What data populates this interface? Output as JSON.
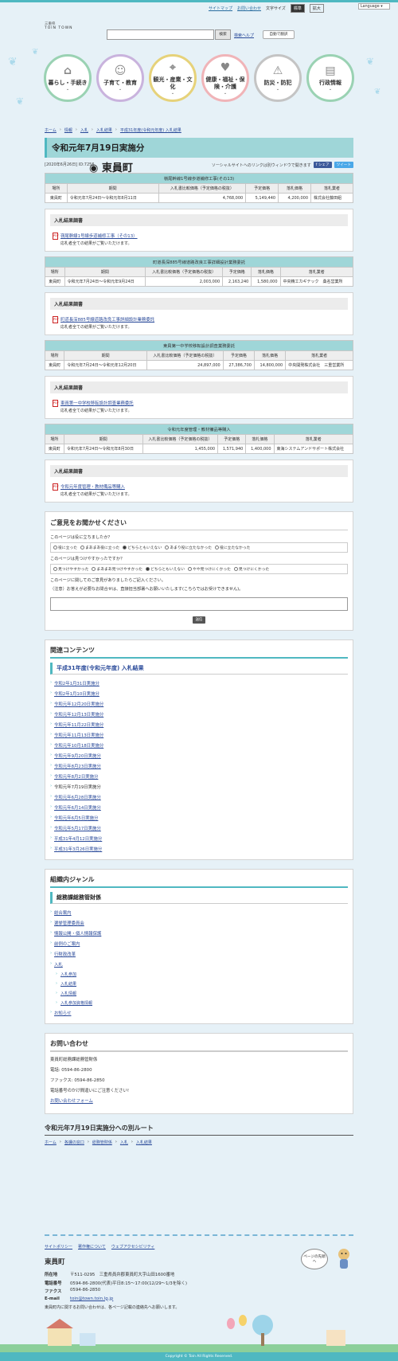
{
  "header": {
    "topbar": {
      "sitemap": "サイトマップ",
      "contact": "お問い合わせ",
      "textsize_label": "文字サイズ",
      "size_standard": "標準",
      "size_large": "拡大",
      "language": "Language"
    },
    "logo": {
      "pref": "三重県",
      "name": "東員町",
      "sub": "TOIN TOWN"
    },
    "search": {
      "placeholder": "",
      "button": "検索",
      "help": "検索ヘルプ",
      "translate": "自動で翻訳"
    },
    "nav": [
      {
        "label": "暮らし・手続き",
        "icon": "home-icon"
      },
      {
        "label": "子育て・教育",
        "icon": "child-icon"
      },
      {
        "label": "観光・産業・文化",
        "icon": "map-icon"
      },
      {
        "label": "健康・福祉・保険・介護",
        "icon": "heart-hands-icon"
      },
      {
        "label": "防災・防犯",
        "icon": "fire-extinguisher-icon"
      },
      {
        "label": "行政情報",
        "icon": "book-icon"
      }
    ]
  },
  "breadcrumb": [
    "ホーム",
    "情報",
    "入札",
    "入札結果",
    "平成31年度(令和元年度) 入札結果"
  ],
  "page": {
    "title": "令和元年7月19日実施分",
    "date": "[2020年6月26日]",
    "id": "ID:7256",
    "share_note": "ソーシャルサイトへのリンクは別ウィンドウで開きます",
    "share_fb": "f シェア",
    "share_tw": "ツイート"
  },
  "table_headers": [
    "場所",
    "期間",
    "入札書比較価格（予定価格の税抜）",
    "予定価格",
    "落札価格",
    "落札業者"
  ],
  "results": [
    {
      "caption": "嶺尾幹線1号線歩道補修工事(その13)",
      "row": [
        "東員町",
        "令和元年7月24日～令和元年8月11日",
        "4,768,000",
        "5,149,440",
        "4,200,000",
        "株式会社藤田組"
      ],
      "doc_title": "入札結果調書",
      "doc_link": "嶺尾幹線1号線歩道補修工事（その13）",
      "doc_note": "応札者全ての結果がご覧いただけます。"
    },
    {
      "caption": "町道長深885号線道路改良工事詳細設計業務委託",
      "row": [
        "東員町",
        "令和元年7月24日～令和元年9月24日",
        "2,003,000",
        "2,163,240",
        "1,580,000",
        "中央精工カギテック　桑名営業所"
      ],
      "doc_title": "入札結果調書",
      "doc_link": "町道長深885号線道路改良工事詳細設計業務委託",
      "doc_note": "応札者全ての結果がご覧いただけます。"
    },
    {
      "caption": "東員第一中学校移転設計調査業務委託",
      "row": [
        "東員町",
        "令和元年7月24日～令和元年12月20日",
        "24,897,000",
        "27,386,700",
        "14,800,000",
        "中央開発株式会社　三重営業所"
      ],
      "doc_title": "入札結果調書",
      "doc_link": "東員第一中学校移転設計調査業務委託",
      "doc_note": "応札者全ての結果がご覧いただけます。"
    },
    {
      "caption": "令和元年度管理・教材備品等購入",
      "row": [
        "東員町",
        "令和元年7月24日～令和元年8月30日",
        "1,455,000",
        "1,571,940",
        "1,400,000",
        "東海システムアンドサポート株式会社"
      ],
      "doc_title": "入札結果調書",
      "doc_link": "令和元年度管理・教材備品等購入",
      "doc_note": "応札者全ての結果がご覧いただけます。"
    }
  ],
  "feedback": {
    "title": "ご意見をお聞かせください",
    "q1": "このページは役に立ちましたか？",
    "q1_options": [
      "役に立った",
      "まあまあ役に立った",
      "どちらともいえない",
      "あまり役に立たなかった",
      "役に立たなかった"
    ],
    "q1_selected": 2,
    "q2": "このページは見つけやすかったですか？",
    "q2_options": [
      "見つけやすかった",
      "まあまあ見つけやすかった",
      "どちらともいえない",
      "やや見つけにくかった",
      "見つけにくかった"
    ],
    "q2_selected": 2,
    "q3": "このページに関してのご意見がありましたらご記入ください。",
    "q3_note": "（注意）お答えが必要なお問合せは、直接担当部署へお願いいたします(こちらではお受けできません)。",
    "submit": "送信"
  },
  "related": {
    "title": "関連コンテンツ",
    "subtitle": "平成31年度(令和元年度) 入札結果",
    "items": [
      "令和2年1月31日実施分",
      "令和2年1月10日実施分",
      "令和元年12月20日実施分",
      "令和元年12月13日実施分",
      "令和元年11月22日実施分",
      "令和元年11月13日実施分",
      "令和元年10月18日実施分",
      "令和元年9月20日実施分",
      "令和元年8月23日実施分",
      "令和元年8月2日実施分",
      "令和元年7月19日実施分",
      "令和元年6月28日実施分",
      "令和元年6月14日実施分",
      "令和元年6月5日実施分",
      "令和元年5月17日実施分",
      "平成31年4月12日実施分",
      "平成31年3月26日実施分"
    ],
    "current_index": 10
  },
  "genre": {
    "title": "組織内ジャンル",
    "subtitle": "総務課総務管財係",
    "items": [
      "総合案内",
      "選挙管理委員会",
      "情報公開・個人情報保護",
      "前例のご案内",
      "行財政改革",
      "入札"
    ],
    "sub_items": [
      "入札参加",
      "入札結果",
      "入札情報",
      "入札参加資格情報"
    ],
    "last": "お知らせ"
  },
  "contact": {
    "title": "お問い合わせ",
    "dept": "東員町総務課総務管財係",
    "tel": "電話: 0594-86-2800",
    "fax": "ファックス: 0594-86-2850",
    "note": "電話番号のかけ間違いにご注意ください!",
    "form": "お問い合わせフォーム"
  },
  "alt_route": {
    "title": "令和元年7月19日実施分への別ルート",
    "crumbs": [
      "ホーム",
      "各課の窓口",
      "総務管財係",
      "入札",
      "入札結果"
    ]
  },
  "footer": {
    "links": [
      "サイトポリシー",
      "著作権について",
      "ウェブアクセシビリティ"
    ],
    "name": "東員町",
    "info": [
      {
        "k": "所在地",
        "v": "〒511-0295　三重県員弁郡東員町大字山田1600番地"
      },
      {
        "k": "電話番号",
        "v": "0594-86-2800(代表)平日8:15～17:00(12/29～1/3を除く)"
      },
      {
        "k": "ファクス",
        "v": "0594-86-2850"
      },
      {
        "k": "E-mail",
        "v": "toin@town.toin.lg.jp"
      }
    ],
    "note": "東員町内に関するお問い合わせは、各ページ記載の連絡先へお願いします。",
    "pagetop": "ページの先頭へ",
    "copyright": "Copyright © Toin All Rights Reserved."
  }
}
